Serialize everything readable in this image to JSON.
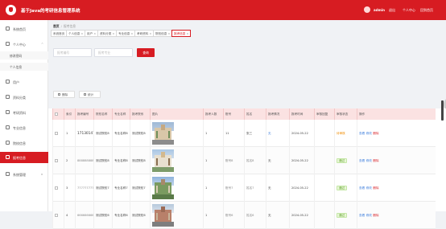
{
  "app": {
    "title": "基于Java的考研信息管理系统"
  },
  "header": {
    "user_name": "admin",
    "links": [
      "退出",
      "个人中心",
      "回到首页"
    ]
  },
  "sidebar": {
    "items": [
      {
        "label": "系统首页",
        "icon": "home-icon"
      },
      {
        "label": "个人中心",
        "icon": "user-icon",
        "expanded": true
      },
      {
        "label": "用户",
        "icon": "users-icon"
      },
      {
        "label": "资料分类",
        "icon": "grid-icon"
      },
      {
        "label": "考研资料",
        "icon": "grid-icon"
      },
      {
        "label": "专业信息",
        "icon": "grid-icon"
      },
      {
        "label": "院校信息",
        "icon": "grid-icon"
      },
      {
        "label": "报考信息",
        "icon": "grid-icon",
        "active": true
      },
      {
        "label": "系统管理",
        "icon": "grid-icon"
      }
    ],
    "subitems": [
      "修改密码",
      "个人信息"
    ]
  },
  "breadcrumb": {
    "home": "首页",
    "current": "报考信息"
  },
  "tabs": [
    {
      "label": "系统首页"
    },
    {
      "label": "个人信息"
    },
    {
      "label": "用户"
    },
    {
      "label": "资料分类"
    },
    {
      "label": "专业信息"
    },
    {
      "label": "考研资料"
    },
    {
      "label": "院校信息"
    },
    {
      "label": "报考信息",
      "active": true
    }
  ],
  "search": {
    "field1_placeholder": "报考编号",
    "field2_placeholder": "报考专业",
    "query_label": "查询"
  },
  "actions": {
    "delete_label": "删除",
    "stats_label": "统计"
  },
  "up_button_icon": "arrow-up-icon",
  "colors": {
    "accent": "#d71c22",
    "header_row": "#fbe2e2",
    "link": "#3b7cdb",
    "pending": "#f08c00",
    "approved": "#5fa12c"
  },
  "table": {
    "columns": [
      "",
      "索引",
      "报考编号",
      "院校名称",
      "专业名称",
      "报考院系",
      "图片",
      "报考人数",
      "账号",
      "姓名",
      "报考情况",
      "报考时间",
      "审核回复",
      "审核状态",
      "操作"
    ],
    "operations": [
      "查看",
      "修改",
      "删除"
    ],
    "rows": [
      {
        "index": "1",
        "number": "1713014759363",
        "school": "测试院校8",
        "major": "专业名称8",
        "dept": "测试院校8",
        "count": "1",
        "account": "11",
        "name": "张三",
        "situation": "无",
        "time": "2024-05-22",
        "reply": "",
        "status": "待审核",
        "status_type": "pending"
      },
      {
        "index": "2",
        "number": "8888888888",
        "school": "测试院校8",
        "major": "专业名称8",
        "dept": "测试院校8",
        "count": "1",
        "account": "账号8",
        "name": "姓名8",
        "situation": "无",
        "time": "2024-05-22",
        "reply": "",
        "status": "通过",
        "status_type": "approved"
      },
      {
        "index": "3",
        "number": "7777777777",
        "school": "测试院校7",
        "major": "专业名称7",
        "dept": "测试院校7",
        "count": "1",
        "account": "账号7",
        "name": "姓名7",
        "situation": "无",
        "time": "2024-05-22",
        "reply": "",
        "status": "通过",
        "status_type": "approved"
      },
      {
        "index": "4",
        "number": "6666666666",
        "school": "测试院校6",
        "major": "专业名称6",
        "dept": "测试院校6",
        "count": "1",
        "account": "账号6",
        "name": "姓名6",
        "situation": "无",
        "time": "2024-05-22",
        "reply": "",
        "status": "通过",
        "status_type": "approved"
      }
    ]
  }
}
